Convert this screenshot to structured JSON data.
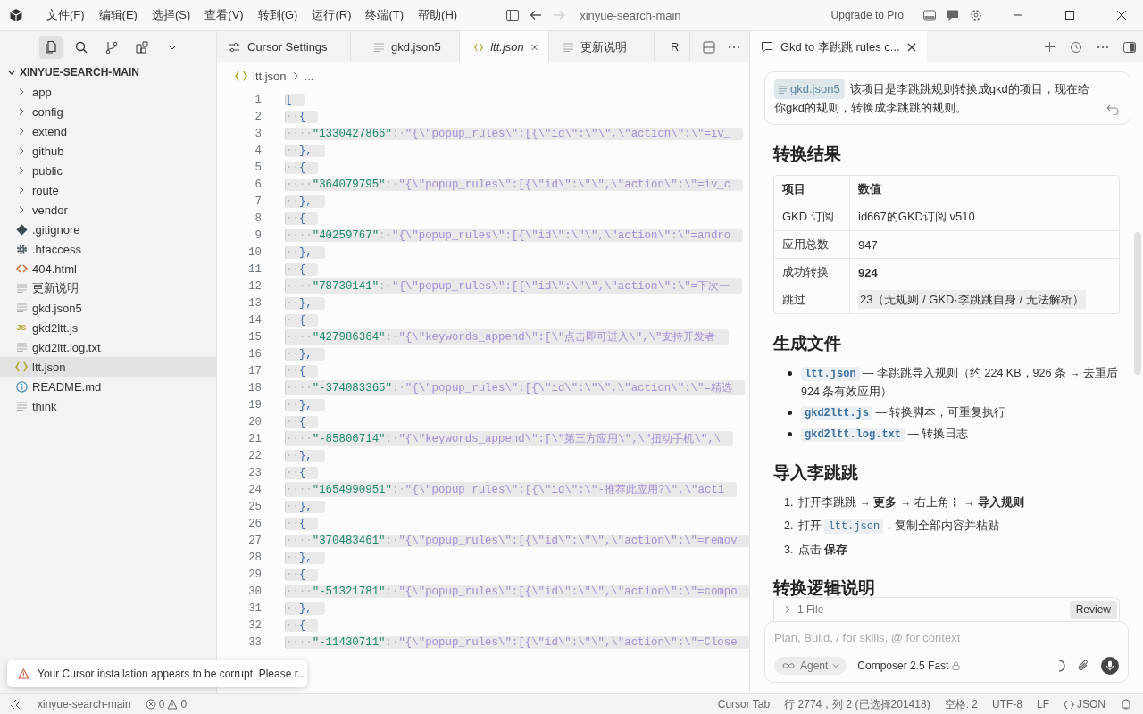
{
  "title_bar": {
    "menus": [
      "文件(F)",
      "编辑(E)",
      "选择(S)",
      "查看(V)",
      "转到(G)",
      "运行(R)",
      "终端(T)",
      "帮助(H)"
    ],
    "title": "xinyue-search-main",
    "upgrade": "Upgrade to Pro"
  },
  "activity": [
    {
      "kind": "files",
      "selected": true
    },
    {
      "kind": "search",
      "selected": false
    },
    {
      "kind": "branch",
      "selected": false
    },
    {
      "kind": "extensions",
      "selected": false
    },
    {
      "kind": "chevron",
      "selected": false
    }
  ],
  "explorer": {
    "label": "XINYUE-SEARCH-MAIN",
    "expanded": true,
    "children": [
      {
        "label": "app",
        "kind": "folder",
        "expanded": false,
        "selected": false
      },
      {
        "label": "config",
        "kind": "folder",
        "expanded": false,
        "selected": false
      },
      {
        "label": "extend",
        "kind": "folder",
        "expanded": false,
        "selected": false
      },
      {
        "label": "github",
        "kind": "folder",
        "expanded": false,
        "selected": false
      },
      {
        "label": "public",
        "kind": "folder",
        "expanded": false,
        "selected": false
      },
      {
        "label": "route",
        "kind": "folder",
        "expanded": false,
        "selected": false
      },
      {
        "label": "vendor",
        "kind": "folder",
        "expanded": false,
        "selected": false
      },
      {
        "label": ".gitignore",
        "kind": "git",
        "selected": false
      },
      {
        "label": ".htaccess",
        "kind": "gear",
        "selected": false
      },
      {
        "label": "404.html",
        "kind": "html",
        "selected": false
      },
      {
        "label": "更新说明",
        "kind": "text",
        "selected": false
      },
      {
        "label": "gkd.json5",
        "kind": "text",
        "selected": false
      },
      {
        "label": "gkd2ltt.js",
        "kind": "js",
        "icon_label": "JS",
        "selected": false
      },
      {
        "label": "gkd2ltt.log.txt",
        "kind": "text",
        "selected": false
      },
      {
        "label": "ltt.json",
        "kind": "json",
        "selected": true
      },
      {
        "label": "README.md",
        "kind": "info",
        "selected": false
      },
      {
        "label": "think",
        "kind": "text",
        "selected": false
      }
    ]
  },
  "tabs": [
    {
      "label": "Cursor Settings",
      "kind": "settings",
      "selected": false
    },
    {
      "label": "gkd.json5",
      "kind": "text",
      "selected": false
    },
    {
      "label": "ltt.json",
      "kind": "json",
      "selected": true
    },
    {
      "label": "更新说明",
      "kind": "text",
      "selected": false
    },
    {
      "label": "R",
      "kind": "info",
      "selected": false
    }
  ],
  "breadcrumb": [
    "ltt.json",
    "..."
  ],
  "code_lines": [
    {
      "n": "1",
      "kind": "punct",
      "text": "["
    },
    {
      "n": "2",
      "kind": "punct",
      "indent": "··",
      "text": "{"
    },
    {
      "n": "3",
      "kind": "pair",
      "indent": "····",
      "key": "\"1330427866\"",
      "sep": ":·",
      "value": "\"{\\\"popup_rules\\\":[{\\\"id\\\":\\\"\\\",\\\"action\\\":\\\"=iv_"
    },
    {
      "n": "4",
      "kind": "punct",
      "indent": "··",
      "text": "},"
    },
    {
      "n": "5",
      "kind": "punct",
      "indent": "··",
      "text": "{"
    },
    {
      "n": "6",
      "kind": "pair",
      "indent": "····",
      "key": "\"364079795\"",
      "sep": ":·",
      "value": "\"{\\\"popup_rules\\\":[{\\\"id\\\":\\\"\\\",\\\"action\\\":\\\"=iv_c"
    },
    {
      "n": "7",
      "kind": "punct",
      "indent": "··",
      "text": "},"
    },
    {
      "n": "8",
      "kind": "punct",
      "indent": "··",
      "text": "{"
    },
    {
      "n": "9",
      "kind": "pair",
      "indent": "····",
      "key": "\"40259767\"",
      "sep": ":·",
      "value": "\"{\\\"popup_rules\\\":[{\\\"id\\\":\\\"\\\",\\\"action\\\":\\\"=andro"
    },
    {
      "n": "10",
      "kind": "punct",
      "indent": "··",
      "text": "},"
    },
    {
      "n": "11",
      "kind": "punct",
      "indent": "··",
      "text": "{"
    },
    {
      "n": "12",
      "kind": "pair",
      "indent": "····",
      "key": "\"78730141\"",
      "sep": ":·",
      "value": "\"{\\\"popup_rules\\\":[{\\\"id\\\":\\\"\\\",\\\"action\\\":\\\"=下次一"
    },
    {
      "n": "13",
      "kind": "punct",
      "indent": "··",
      "text": "},"
    },
    {
      "n": "14",
      "kind": "punct",
      "indent": "··",
      "text": "{"
    },
    {
      "n": "15",
      "kind": "pair",
      "indent": "····",
      "key": "\"427986364\"",
      "sep": ":·",
      "value": "\"{\\\"keywords_append\\\":[\\\"点击即可进入\\\",\\\"支持开发者"
    },
    {
      "n": "16",
      "kind": "punct",
      "indent": "··",
      "text": "},"
    },
    {
      "n": "17",
      "kind": "punct",
      "indent": "··",
      "text": "{"
    },
    {
      "n": "18",
      "kind": "pair",
      "indent": "····",
      "key": "\"-374083365\"",
      "sep": ":·",
      "value": "\"{\\\"popup_rules\\\":[{\\\"id\\\":\\\"\\\",\\\"action\\\":\\\"=精选"
    },
    {
      "n": "19",
      "kind": "punct",
      "indent": "··",
      "text": "},"
    },
    {
      "n": "20",
      "kind": "punct",
      "indent": "··",
      "text": "{"
    },
    {
      "n": "21",
      "kind": "pair",
      "indent": "····",
      "key": "\"-85806714\"",
      "sep": ":·",
      "value": "\"{\\\"keywords_append\\\":[\\\"第三方应用\\\",\\\"扭动手机\\\",\\"
    },
    {
      "n": "22",
      "kind": "punct",
      "indent": "··",
      "text": "},"
    },
    {
      "n": "23",
      "kind": "punct",
      "indent": "··",
      "text": "{"
    },
    {
      "n": "24",
      "kind": "pair",
      "indent": "····",
      "key": "\"1654990951\"",
      "sep": ":·",
      "value": "\"{\\\"popup_rules\\\":[{\\\"id\\\":\\\"-推荐此应用?\\\",\\\"acti"
    },
    {
      "n": "25",
      "kind": "punct",
      "indent": "··",
      "text": "},"
    },
    {
      "n": "26",
      "kind": "punct",
      "indent": "··",
      "text": "{"
    },
    {
      "n": "27",
      "kind": "pair",
      "indent": "····",
      "key": "\"370483461\"",
      "sep": ":·",
      "value": "\"{\\\"popup_rules\\\":[{\\\"id\\\":\\\"\\\",\\\"action\\\":\\\"=remov"
    },
    {
      "n": "28",
      "kind": "punct",
      "indent": "··",
      "text": "},"
    },
    {
      "n": "29",
      "kind": "punct",
      "indent": "··",
      "text": "{"
    },
    {
      "n": "30",
      "kind": "pair",
      "indent": "····",
      "key": "\"-51321781\"",
      "sep": ":·",
      "value": "\"{\\\"popup_rules\\\":[{\\\"id\\\":\\\"\\\",\\\"action\\\":\\\"=compo"
    },
    {
      "n": "31",
      "kind": "punct",
      "indent": "··",
      "text": "},"
    },
    {
      "n": "32",
      "kind": "punct",
      "indent": "··",
      "text": "{"
    },
    {
      "n": "33",
      "kind": "pair",
      "indent": "····",
      "key": "\"-11430711\"",
      "sep": ":·",
      "value": "\"{\\\"popup_rules\\\":[{\\\"id\\\":\\\"\\\",\\\"action\\\":\\\"=Close"
    }
  ],
  "toast": {
    "text": "Your Cursor installation appears to be corrupt. Please r..."
  },
  "chat": {
    "tab": "Gkd to 李跳跳 rules c...",
    "message": {
      "chip": "gkd.json5",
      "text": "该项目是李跳跳规则转换成gkd的项目，现在给",
      "continuation": "你gkd的规则，转换成李跳跳的规则。"
    },
    "sections": [
      {
        "kind": "heading",
        "text": "转换结果"
      },
      {
        "kind": "table",
        "columns": [
          "项目",
          "数值"
        ],
        "rows": [
          {
            "cells": [
              "GKD 订阅",
              "id667的GKD订阅 v510"
            ],
            "strong": false,
            "highlighted": false
          },
          {
            "cells": [
              "应用总数",
              "947"
            ],
            "strong": false,
            "highlighted": false
          },
          {
            "cells": [
              "成功转换",
              "924"
            ],
            "strong": true,
            "highlighted": false
          },
          {
            "cells": [
              "跳过",
              "23（无规则 / GKD·李跳跳自身 / 无法解析）"
            ],
            "strong": false,
            "highlighted": true
          }
        ]
      },
      {
        "kind": "heading",
        "text": "生成文件"
      },
      {
        "kind": "bullets",
        "items": [
          [
            {
              "kind": "code",
              "text": "ltt.json"
            },
            {
              "kind": "text",
              "text": " — 李跳跳导入规则（约 224 KB，926 条 → 去重后"
            },
            {
              "kind": "line",
              "text": "924 条有效应用）"
            }
          ],
          [
            {
              "kind": "code",
              "text": "gkd2ltt.js"
            },
            {
              "kind": "text",
              "text": " — 转换脚本，可重复执行"
            }
          ],
          [
            {
              "kind": "code",
              "text": "gkd2ltt.log.txt"
            },
            {
              "kind": "text",
              "text": " — 转换日志"
            }
          ]
        ]
      },
      {
        "kind": "heading",
        "text": "导入李跳跳"
      },
      {
        "kind": "steps",
        "items": [
          {
            "num": "1.",
            "parts": [
              {
                "kind": "text",
                "text": "打开李跳跳 → **更多** → 右上角**⋮** → **导入规则**"
              }
            ]
          },
          {
            "num": "2.",
            "parts": [
              {
                "kind": "text",
                "text": "打开 "
              },
              {
                "kind": "code",
                "text": "ltt.json"
              },
              {
                "kind": "text",
                "text": "，复制全部内容并粘贴"
              }
            ]
          },
          {
            "num": "3.",
            "parts": [
              {
                "kind": "text",
                "text": "点击 **保存**"
              }
            ]
          }
        ]
      },
      {
        "kind": "heading",
        "text": "转换逻辑说明"
      }
    ],
    "changes": {
      "label": "1 File",
      "expanded": false,
      "button": "Review"
    },
    "input": {
      "placeholder": "Plan, Build, / for skills, @ for context",
      "mode": "Agent",
      "model": "Composer 2.5 Fast"
    }
  },
  "status_bar": {
    "branch": "xinyue-search-main",
    "errors": "0",
    "warnings": "0",
    "items": [
      "Cursor Tab",
      "行 2774，列 2 (已选择201418)",
      "空格: 2",
      "UTF-8",
      "LF"
    ],
    "language": "JSON"
  }
}
